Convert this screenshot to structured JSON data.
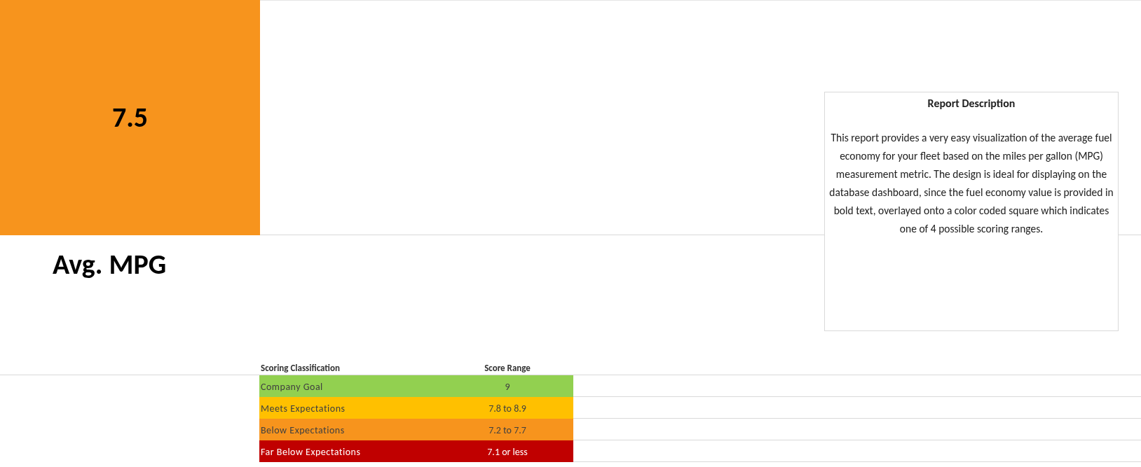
{
  "tile": {
    "value": "7.5",
    "color": "#f7941d"
  },
  "metric_label": "Avg. MPG",
  "description": {
    "title": "Report Description",
    "text": "This report provides a very easy visualization of the average fuel economy for your fleet based on the miles per gallon (MPG) measurement metric. The design is ideal for displaying on the database dashboard, since the fuel economy value is provided in bold text, overlayed onto a color coded square which indicates one of 4 possible scoring ranges."
  },
  "scoring_table": {
    "columns": [
      "Scoring Classification",
      "Score Range"
    ],
    "rows": [
      {
        "classification": "Company Goal",
        "range": "9",
        "color": "#92d050"
      },
      {
        "classification": "Meets Expectations",
        "range": "7.8 to 8.9",
        "color": "#ffc000"
      },
      {
        "classification": "Below Expectations",
        "range": "7.2 to 7.7",
        "color": "#f7941d"
      },
      {
        "classification": "Far Below Expectations",
        "range": "7.1 or less",
        "color": "#c00000"
      }
    ]
  }
}
